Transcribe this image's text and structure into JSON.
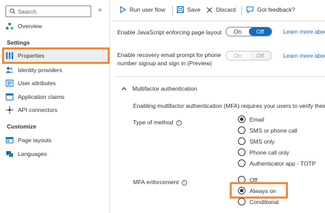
{
  "sidebar": {
    "search_placeholder": "Search",
    "collapse_glyph": "«",
    "overview_label": "Overview",
    "settings_title": "Settings",
    "settings_items": [
      {
        "label": "Properties",
        "icon": "properties-icon",
        "active": true
      },
      {
        "label": "Identity providers",
        "icon": "identity-providers-icon"
      },
      {
        "label": "User attributes",
        "icon": "user-attributes-icon"
      },
      {
        "label": "Application claims",
        "icon": "application-claims-icon"
      },
      {
        "label": "API connectors",
        "icon": "api-connectors-icon"
      }
    ],
    "customize_title": "Customize",
    "customize_items": [
      {
        "label": "Page layouts",
        "icon": "page-layouts-icon"
      },
      {
        "label": "Languages",
        "icon": "languages-icon"
      }
    ]
  },
  "toolbar": {
    "run_label": "Run user flow",
    "save_label": "Save",
    "discard_label": "Discard",
    "feedback_label": "Got feedback?"
  },
  "main": {
    "js_label": "Enable JavaScript enforcing page layout",
    "js_toggle": {
      "on": "On",
      "off": "Off",
      "selected": "Off"
    },
    "learn_more": "Learn more abou",
    "recovery_label_1": "Enable recovery email prompt for phone",
    "recovery_label_2": "number signup and sign in (Preview)",
    "recovery_toggle": {
      "on": "On",
      "off": "Off",
      "selected": "Off"
    },
    "mfa_section_title": "Multifactor authentication",
    "mfa_description": "Enabling multifactor authentication (MFA) requires your users to verify their iden",
    "type_of_method_label": "Type of method",
    "methods": [
      {
        "label": "Email",
        "checked": true
      },
      {
        "label": "SMS or phone call",
        "checked": false
      },
      {
        "label": "SMS only",
        "checked": false
      },
      {
        "label": "Phone call only",
        "checked": false
      },
      {
        "label": "Authenticator app - TOTP",
        "checked": false
      }
    ],
    "mfa_enforcement_label": "MFA enforcement",
    "enforcement": [
      {
        "label": "Off",
        "checked": false
      },
      {
        "label": "Always on",
        "checked": true
      },
      {
        "label": "Conditional",
        "checked": false
      }
    ]
  },
  "colors": {
    "accent": "#0f6cbd",
    "highlight": "#f28a3a"
  }
}
